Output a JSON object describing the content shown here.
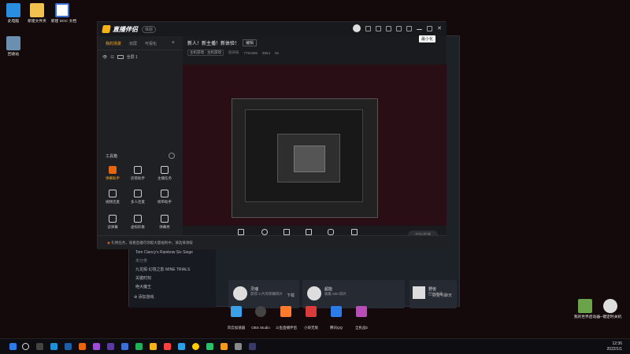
{
  "desktop": {
    "icons": [
      {
        "label": "此电脑",
        "color": "#2a8ee0"
      },
      {
        "label": "新建文件夹",
        "color": "#f2c14e"
      },
      {
        "label": "新建 DOC 文档",
        "color": "#3b6fd6"
      },
      {
        "label": "回收站",
        "color": "#6b8fb0"
      }
    ],
    "right_icons": [
      {
        "label": "我的世界启动器",
        "color": "#6aa34a"
      },
      {
        "label": "一键定时关机",
        "color": "#dddddd"
      }
    ],
    "dock": [
      {
        "label": "风云加速器",
        "color": "#3aa0e8"
      },
      {
        "label": "OBS Studio",
        "color": "#444444"
      },
      {
        "label": "斗鱼直播伴侣",
        "color": "#ff7a2b"
      },
      {
        "label": "小柒无限",
        "color": "#d93b3b"
      },
      {
        "label": "腾讯QQ",
        "color": "#2b7be8"
      },
      {
        "label": "全民战2",
        "color": "#b84db8"
      }
    ]
  },
  "app": {
    "name": "直播伴侣",
    "version": "体验",
    "tooltip": "最小化",
    "tabs": [
      "我的场景",
      "双屏",
      "可视化"
    ],
    "active_tab": "我的场景",
    "scene_label": "全屏 1",
    "tools_header": "工具箱",
    "tools": [
      {
        "label": "弹幕助手",
        "hot": true
      },
      {
        "label": "房管助手",
        "hot": false
      },
      {
        "label": "主播任务",
        "hot": false
      },
      {
        "label": "视频连麦",
        "hot": false
      },
      {
        "label": "多人连麦",
        "hot": false
      },
      {
        "label": "榜单助手",
        "hot": false
      },
      {
        "label": "读弹幕",
        "hot": false
      },
      {
        "label": "虚拟形象",
        "hot": false
      },
      {
        "label": "弹幕秀",
        "hot": false
      }
    ],
    "stream_title": "新人！新主播！新体验！",
    "edit_label": "编辑",
    "category": "主机游戏 · 主机游戏",
    "room_label": "房间号",
    "room_id": "7791896",
    "fans": "9864",
    "followers": "56",
    "controls": [
      "直播屏幕",
      "摄像头",
      "手机投屏",
      "多媒体",
      "麦克风",
      "扬声器"
    ],
    "start_button": "开始直播",
    "stats": [
      "丢包率",
      "码率",
      "CPU",
      "内存",
      "帧率"
    ],
    "notice": "礼物任务，观看直播可领取大量福利中，请选择领取"
  },
  "game": {
    "sidebar_items": [
      "Tom Clancy's Rainbow Six Siege",
      "未分类",
      "九龙殿·幻境之影 MINE TRIALS",
      "关键时刻",
      "绝大魔王"
    ],
    "add_label": "添加游戏",
    "cards": [
      {
        "title": "灵魂",
        "sub": "获得 3 片的荣耀碎片"
      },
      {
        "title": "超能",
        "sub": "收集 600 碎片"
      },
      {
        "title": "野兽",
        "sub": "回合收藏"
      }
    ],
    "download_label": "下载",
    "friends_label": "好友与聊天"
  },
  "taskbar": {
    "time": "12:36",
    "date": "2022/1/1",
    "icon_colors": [
      "#2b7be8",
      "#ddd",
      "#444",
      "#1e90d8",
      "#1d5ea8",
      "#e8650f",
      "#a04bd6",
      "#5a3b9e",
      "#3b6fd6",
      "#1fb25a",
      "#f5b31a",
      "#ff4040",
      "#2aa0e8",
      "#ffcc00",
      "#2ac06a",
      "#f59b1a",
      "#888",
      "#3a3a6a"
    ]
  }
}
